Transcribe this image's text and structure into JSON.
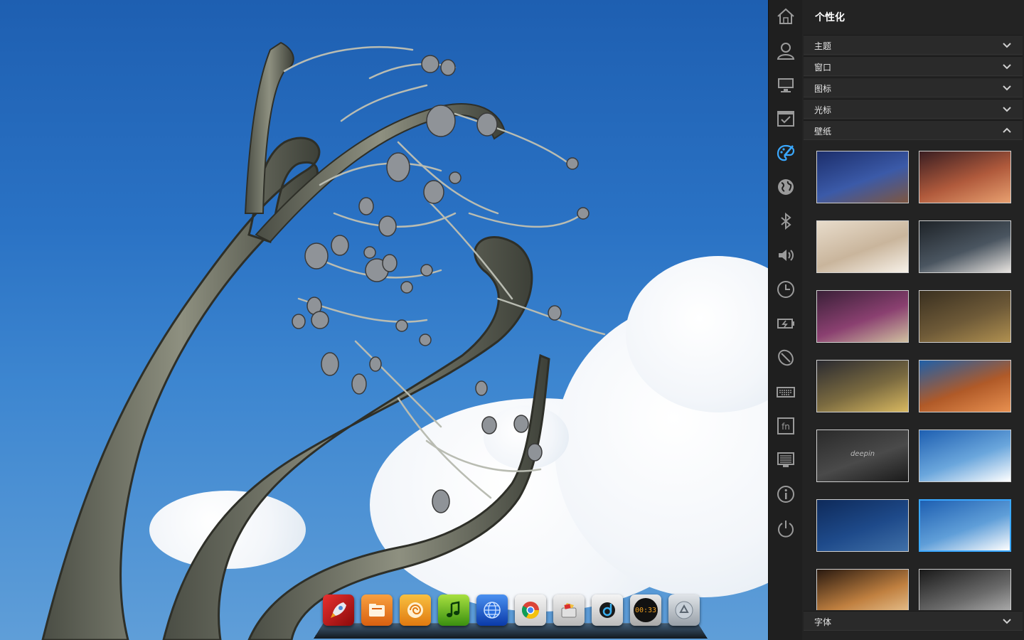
{
  "panel": {
    "title": "个性化",
    "sections": [
      {
        "label": "主题",
        "expanded": false
      },
      {
        "label": "窗口",
        "expanded": false
      },
      {
        "label": "图标",
        "expanded": false
      },
      {
        "label": "光标",
        "expanded": false
      },
      {
        "label": "壁纸",
        "expanded": true
      }
    ],
    "bottom_section": {
      "label": "字体",
      "expanded": false
    },
    "accent_color": "#3aa8ff",
    "wallpapers": [
      {
        "name": "starry-rock",
        "colors": [
          "#1c2e6b",
          "#3b5aa8",
          "#7d5640"
        ]
      },
      {
        "name": "canyon-sunset",
        "colors": [
          "#3a1e22",
          "#b05a3c",
          "#e8a070"
        ]
      },
      {
        "name": "bright-room",
        "colors": [
          "#e8dccb",
          "#c9b59c",
          "#f7f1e8"
        ]
      },
      {
        "name": "cherry-blossom",
        "colors": [
          "#1e2328",
          "#4a5560",
          "#e8e4e0"
        ]
      },
      {
        "name": "bridge-night",
        "colors": [
          "#3a2038",
          "#8a4070",
          "#d0c0a0"
        ]
      },
      {
        "name": "golden-grass",
        "colors": [
          "#3a3020",
          "#6e5a38",
          "#b09050"
        ]
      },
      {
        "name": "paper-boat",
        "colors": [
          "#2a2a30",
          "#7a6a40",
          "#d8b860"
        ]
      },
      {
        "name": "rock-arch",
        "colors": [
          "#2060a8",
          "#b05a28",
          "#e89050"
        ]
      },
      {
        "name": "deepin-dark",
        "colors": [
          "#2a2a2a",
          "#4a4a4a",
          "#1a1a1a"
        ],
        "caption": "deepin"
      },
      {
        "name": "blue-sky-clouds",
        "colors": [
          "#1e5fb1",
          "#6aa6dc",
          "#ffffff"
        ]
      },
      {
        "name": "seagull-ocean",
        "colors": [
          "#0e2a5a",
          "#1e4a8a",
          "#4070a8"
        ]
      },
      {
        "name": "tree-sky",
        "colors": [
          "#1e5fb1",
          "#5f9ed8",
          "#ffffff"
        ],
        "selected": true
      },
      {
        "name": "lanterns",
        "colors": [
          "#2a1a10",
          "#c08040",
          "#f0d0a0"
        ]
      },
      {
        "name": "monochrome-street",
        "colors": [
          "#1a1a1a",
          "#6a6a6a",
          "#c0c0c0"
        ]
      }
    ]
  },
  "rail": {
    "items": [
      {
        "name": "home",
        "active": false
      },
      {
        "name": "account",
        "active": false
      },
      {
        "name": "display",
        "active": false
      },
      {
        "name": "default-apps",
        "active": false
      },
      {
        "name": "personalization",
        "active": true
      },
      {
        "name": "network",
        "active": false
      },
      {
        "name": "bluetooth",
        "active": false
      },
      {
        "name": "sound",
        "active": false
      },
      {
        "name": "date-time",
        "active": false
      },
      {
        "name": "power",
        "active": false
      },
      {
        "name": "mouse",
        "active": false
      },
      {
        "name": "keyboard",
        "active": false
      },
      {
        "name": "shortcuts",
        "active": false
      },
      {
        "name": "grub",
        "active": false
      },
      {
        "name": "system-info",
        "active": false
      },
      {
        "name": "shutdown",
        "active": false
      }
    ]
  },
  "dock": {
    "apps": [
      {
        "name": "launcher"
      },
      {
        "name": "file-manager"
      },
      {
        "name": "deepin-music"
      },
      {
        "name": "music-player"
      },
      {
        "name": "browser-globe"
      },
      {
        "name": "chrome"
      },
      {
        "name": "software-center"
      },
      {
        "name": "deepin-movie"
      },
      {
        "name": "clock",
        "text": "00:33"
      },
      {
        "name": "trash"
      }
    ]
  }
}
